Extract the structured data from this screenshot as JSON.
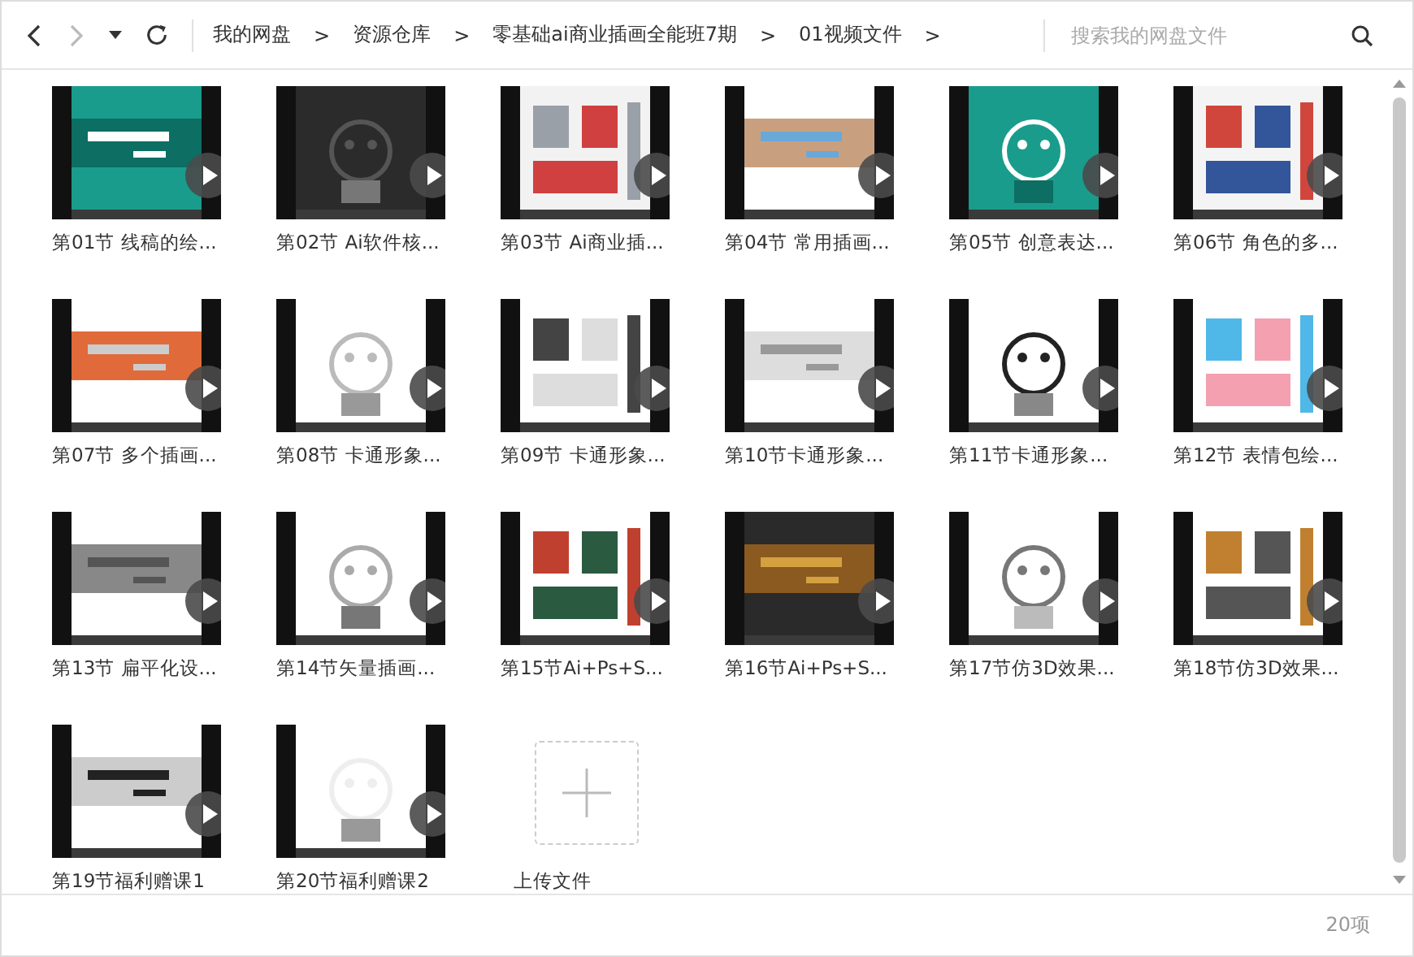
{
  "toolbar": {
    "breadcrumbs": [
      "我的网盘",
      "资源仓库",
      "零基础ai商业插画全能班7期",
      "01视频文件"
    ],
    "separator": ">",
    "search": {
      "placeholder": "搜索我的网盘文件"
    }
  },
  "files": [
    {
      "name": "第01节 线稿的绘...",
      "kind": "video"
    },
    {
      "name": "第02节 Ai软件核...",
      "kind": "video"
    },
    {
      "name": "第03节 Ai商业插...",
      "kind": "video"
    },
    {
      "name": "第04节 常用插画...",
      "kind": "video"
    },
    {
      "name": "第05节 创意表达...",
      "kind": "video"
    },
    {
      "name": "第06节 角色的多...",
      "kind": "video"
    },
    {
      "name": "第07节 多个插画...",
      "kind": "video"
    },
    {
      "name": "第08节 卡通形象...",
      "kind": "video"
    },
    {
      "name": "第09节 卡通形象...",
      "kind": "video"
    },
    {
      "name": "第10节卡通形象...",
      "kind": "video"
    },
    {
      "name": "第11节卡通形象...",
      "kind": "video"
    },
    {
      "name": "第12节 表情包绘...",
      "kind": "video"
    },
    {
      "name": "第13节 扁平化设...",
      "kind": "video"
    },
    {
      "name": "第14节矢量插画...",
      "kind": "video"
    },
    {
      "name": "第15节Ai+Ps+S...",
      "kind": "video"
    },
    {
      "name": "第16节Ai+Ps+S...",
      "kind": "video"
    },
    {
      "name": "第17节仿3D效果...",
      "kind": "video"
    },
    {
      "name": "第18节仿3D效果...",
      "kind": "video"
    },
    {
      "name": "第19节福利赠课1",
      "kind": "video"
    },
    {
      "name": "第20节福利赠课2",
      "kind": "video"
    },
    {
      "name": "上传文件",
      "kind": "upload"
    }
  ],
  "status_bar": {
    "count": "20项"
  }
}
